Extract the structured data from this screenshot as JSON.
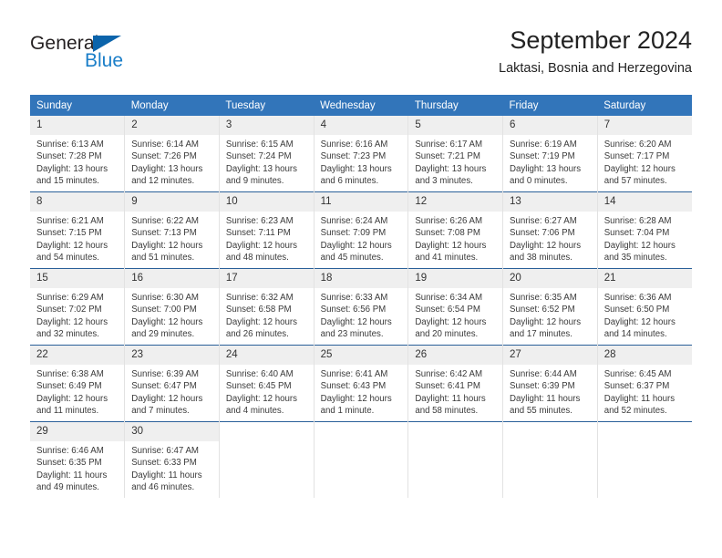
{
  "brand": {
    "name_part1": "General",
    "name_part2": "Blue",
    "triangle_color": "#0b64ab",
    "blue_color": "#1a7ec8"
  },
  "header": {
    "title": "September 2024",
    "subtitle": "Laktasi, Bosnia and Herzegovina"
  },
  "theme": {
    "header_bg": "#3275ba",
    "daynum_bg": "#efefef",
    "row_divider": "#2a6099"
  },
  "weekdays": [
    "Sunday",
    "Monday",
    "Tuesday",
    "Wednesday",
    "Thursday",
    "Friday",
    "Saturday"
  ],
  "weeks": [
    [
      {
        "day": "1",
        "sunrise": "Sunrise: 6:13 AM",
        "sunset": "Sunset: 7:28 PM",
        "daylight": "Daylight: 13 hours and 15 minutes."
      },
      {
        "day": "2",
        "sunrise": "Sunrise: 6:14 AM",
        "sunset": "Sunset: 7:26 PM",
        "daylight": "Daylight: 13 hours and 12 minutes."
      },
      {
        "day": "3",
        "sunrise": "Sunrise: 6:15 AM",
        "sunset": "Sunset: 7:24 PM",
        "daylight": "Daylight: 13 hours and 9 minutes."
      },
      {
        "day": "4",
        "sunrise": "Sunrise: 6:16 AM",
        "sunset": "Sunset: 7:23 PM",
        "daylight": "Daylight: 13 hours and 6 minutes."
      },
      {
        "day": "5",
        "sunrise": "Sunrise: 6:17 AM",
        "sunset": "Sunset: 7:21 PM",
        "daylight": "Daylight: 13 hours and 3 minutes."
      },
      {
        "day": "6",
        "sunrise": "Sunrise: 6:19 AM",
        "sunset": "Sunset: 7:19 PM",
        "daylight": "Daylight: 13 hours and 0 minutes."
      },
      {
        "day": "7",
        "sunrise": "Sunrise: 6:20 AM",
        "sunset": "Sunset: 7:17 PM",
        "daylight": "Daylight: 12 hours and 57 minutes."
      }
    ],
    [
      {
        "day": "8",
        "sunrise": "Sunrise: 6:21 AM",
        "sunset": "Sunset: 7:15 PM",
        "daylight": "Daylight: 12 hours and 54 minutes."
      },
      {
        "day": "9",
        "sunrise": "Sunrise: 6:22 AM",
        "sunset": "Sunset: 7:13 PM",
        "daylight": "Daylight: 12 hours and 51 minutes."
      },
      {
        "day": "10",
        "sunrise": "Sunrise: 6:23 AM",
        "sunset": "Sunset: 7:11 PM",
        "daylight": "Daylight: 12 hours and 48 minutes."
      },
      {
        "day": "11",
        "sunrise": "Sunrise: 6:24 AM",
        "sunset": "Sunset: 7:09 PM",
        "daylight": "Daylight: 12 hours and 45 minutes."
      },
      {
        "day": "12",
        "sunrise": "Sunrise: 6:26 AM",
        "sunset": "Sunset: 7:08 PM",
        "daylight": "Daylight: 12 hours and 41 minutes."
      },
      {
        "day": "13",
        "sunrise": "Sunrise: 6:27 AM",
        "sunset": "Sunset: 7:06 PM",
        "daylight": "Daylight: 12 hours and 38 minutes."
      },
      {
        "day": "14",
        "sunrise": "Sunrise: 6:28 AM",
        "sunset": "Sunset: 7:04 PM",
        "daylight": "Daylight: 12 hours and 35 minutes."
      }
    ],
    [
      {
        "day": "15",
        "sunrise": "Sunrise: 6:29 AM",
        "sunset": "Sunset: 7:02 PM",
        "daylight": "Daylight: 12 hours and 32 minutes."
      },
      {
        "day": "16",
        "sunrise": "Sunrise: 6:30 AM",
        "sunset": "Sunset: 7:00 PM",
        "daylight": "Daylight: 12 hours and 29 minutes."
      },
      {
        "day": "17",
        "sunrise": "Sunrise: 6:32 AM",
        "sunset": "Sunset: 6:58 PM",
        "daylight": "Daylight: 12 hours and 26 minutes."
      },
      {
        "day": "18",
        "sunrise": "Sunrise: 6:33 AM",
        "sunset": "Sunset: 6:56 PM",
        "daylight": "Daylight: 12 hours and 23 minutes."
      },
      {
        "day": "19",
        "sunrise": "Sunrise: 6:34 AM",
        "sunset": "Sunset: 6:54 PM",
        "daylight": "Daylight: 12 hours and 20 minutes."
      },
      {
        "day": "20",
        "sunrise": "Sunrise: 6:35 AM",
        "sunset": "Sunset: 6:52 PM",
        "daylight": "Daylight: 12 hours and 17 minutes."
      },
      {
        "day": "21",
        "sunrise": "Sunrise: 6:36 AM",
        "sunset": "Sunset: 6:50 PM",
        "daylight": "Daylight: 12 hours and 14 minutes."
      }
    ],
    [
      {
        "day": "22",
        "sunrise": "Sunrise: 6:38 AM",
        "sunset": "Sunset: 6:49 PM",
        "daylight": "Daylight: 12 hours and 11 minutes."
      },
      {
        "day": "23",
        "sunrise": "Sunrise: 6:39 AM",
        "sunset": "Sunset: 6:47 PM",
        "daylight": "Daylight: 12 hours and 7 minutes."
      },
      {
        "day": "24",
        "sunrise": "Sunrise: 6:40 AM",
        "sunset": "Sunset: 6:45 PM",
        "daylight": "Daylight: 12 hours and 4 minutes."
      },
      {
        "day": "25",
        "sunrise": "Sunrise: 6:41 AM",
        "sunset": "Sunset: 6:43 PM",
        "daylight": "Daylight: 12 hours and 1 minute."
      },
      {
        "day": "26",
        "sunrise": "Sunrise: 6:42 AM",
        "sunset": "Sunset: 6:41 PM",
        "daylight": "Daylight: 11 hours and 58 minutes."
      },
      {
        "day": "27",
        "sunrise": "Sunrise: 6:44 AM",
        "sunset": "Sunset: 6:39 PM",
        "daylight": "Daylight: 11 hours and 55 minutes."
      },
      {
        "day": "28",
        "sunrise": "Sunrise: 6:45 AM",
        "sunset": "Sunset: 6:37 PM",
        "daylight": "Daylight: 11 hours and 52 minutes."
      }
    ],
    [
      {
        "day": "29",
        "sunrise": "Sunrise: 6:46 AM",
        "sunset": "Sunset: 6:35 PM",
        "daylight": "Daylight: 11 hours and 49 minutes."
      },
      {
        "day": "30",
        "sunrise": "Sunrise: 6:47 AM",
        "sunset": "Sunset: 6:33 PM",
        "daylight": "Daylight: 11 hours and 46 minutes."
      },
      {
        "day": "",
        "sunrise": "",
        "sunset": "",
        "daylight": ""
      },
      {
        "day": "",
        "sunrise": "",
        "sunset": "",
        "daylight": ""
      },
      {
        "day": "",
        "sunrise": "",
        "sunset": "",
        "daylight": ""
      },
      {
        "day": "",
        "sunrise": "",
        "sunset": "",
        "daylight": ""
      },
      {
        "day": "",
        "sunrise": "",
        "sunset": "",
        "daylight": ""
      }
    ]
  ]
}
